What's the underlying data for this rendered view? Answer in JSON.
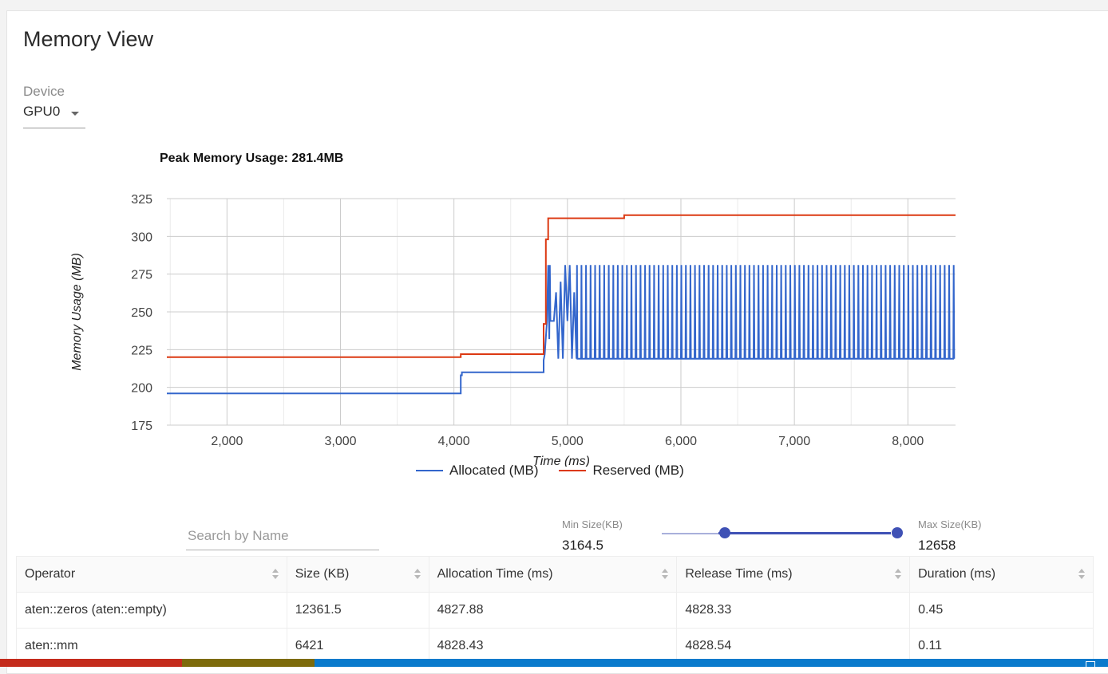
{
  "page": {
    "title": "Memory View"
  },
  "device": {
    "label": "Device",
    "value": "GPU0"
  },
  "chart_data": {
    "type": "line",
    "title": "Peak Memory Usage: 281.4MB",
    "xlabel": "Time (ms)",
    "ylabel": "Memory Usage (MB)",
    "xlim": [
      1470,
      8420
    ],
    "ylim": [
      175,
      325
    ],
    "xticks": [
      "2,000",
      "3,000",
      "4,000",
      "5,000",
      "6,000",
      "7,000",
      "8,000"
    ],
    "yticks": [
      "325",
      "300",
      "275",
      "250",
      "225",
      "200",
      "175"
    ],
    "grid": true,
    "legend": "bottom",
    "series": [
      {
        "name": "Allocated (MB)",
        "color": "#3366cc",
        "x": [
          1470,
          4060,
          4060,
          4070,
          4070,
          4790,
          4790,
          4800,
          4820,
          4830,
          4840,
          4845,
          4850,
          4860,
          4880,
          4900,
          4920,
          4940,
          4960,
          4980,
          5000,
          5020,
          5040,
          5060,
          5080
        ],
        "y": [
          196,
          196,
          208,
          208,
          210,
          210,
          218,
          222,
          244,
          281,
          232,
          281,
          244,
          244,
          244,
          263,
          219,
          270,
          219,
          281,
          244,
          281,
          219,
          263,
          219
        ],
        "oscillation": {
          "x_start": 5080,
          "x_end": 8420,
          "low": 219,
          "high": 281,
          "period_ms": 40
        }
      },
      {
        "name": "Reserved (MB)",
        "color": "#dc3912",
        "x": [
          1470,
          4060,
          4060,
          4790,
          4790,
          4810,
          4810,
          4830,
          4830,
          4850,
          4850,
          5500,
          5500,
          8420
        ],
        "y": [
          220,
          220,
          222,
          222,
          242,
          242,
          298,
          298,
          312,
          312,
          312,
          312,
          314,
          314
        ]
      }
    ]
  },
  "filters": {
    "search_placeholder": "Search by Name",
    "min_label": "Min Size(KB)",
    "min_value": "3164.5",
    "max_label": "Max Size(KB)",
    "max_value": "12658",
    "slider": {
      "range_min": 0,
      "range_max": 12658,
      "low": 3164.5,
      "high": 12658
    }
  },
  "table": {
    "headers": [
      "Operator",
      "Size (KB)",
      "Allocation Time (ms)",
      "Release Time (ms)",
      "Duration (ms)"
    ],
    "rows": [
      [
        "aten::zeros (aten::empty)",
        "12361.5",
        "4827.88",
        "4828.33",
        "0.45"
      ],
      [
        "aten::mm",
        "6421",
        "4828.43",
        "4828.54",
        "0.11"
      ]
    ]
  },
  "colors": {
    "accent": "#3f51b5",
    "status_bar": "#0a7acc",
    "status_red": "#c42b1c",
    "status_olive": "#7d6b0b"
  }
}
